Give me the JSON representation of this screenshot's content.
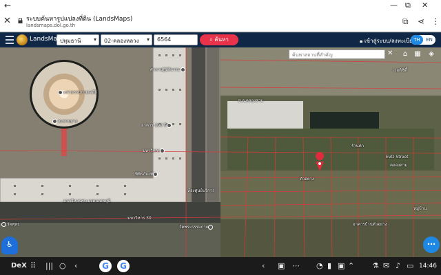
{
  "android": {
    "back_icon": "arrow-left-icon"
  },
  "browser": {
    "title": "ระบบค้นหารูปแปลงที่ดิน (LandsMaps)",
    "url": "landsmaps.dol.go.th"
  },
  "header": {
    "brand": "LandsMaps",
    "province": "ปทุมธานี",
    "district": "02-คลองหลวง",
    "parcel_number": "6564",
    "search_button": "ค้นหา",
    "login": "เข้าสู่ระบบ/ลงทะเบียน",
    "lang_th": "TH",
    "lang_en": "EN"
  },
  "map": {
    "search_placeholder": "ค้นหาสถานที่สำคัญ",
    "labels": {
      "dhammakaya": "มหาธรรมกายเจดีย์",
      "l_a": "สะพานยาง",
      "l_b": "ศาลาปฏิบัติธรรม",
      "l_c": "อาคาร 100 ปี",
      "l_d": "มหาวิหาร",
      "l_e": "พิพิธภัณฑ์",
      "l_f": "มหาวิหารพระมงคลเทพมุนี",
      "l_g": "ห้องศูนย์บริการ",
      "l_h": "มหาวิหาร 30",
      "l_i": "วัดพระธรรมกาย",
      "l_j": "EVD Street",
      "l_k": "คลองสาม",
      "l_l": "ตัวอย่าง",
      "l_m": "เวสต์ซิตี้",
      "l_n": "ร้านค้า",
      "l_o": "อาคารบ้านตัวอย่าง",
      "l_p": "หมู่บ้าน",
      "l_q": "ถนนคลองสาม",
      "l_r": "วัดพุทธ"
    }
  },
  "taskbar": {
    "dex": "DeX",
    "time": "14:46"
  }
}
